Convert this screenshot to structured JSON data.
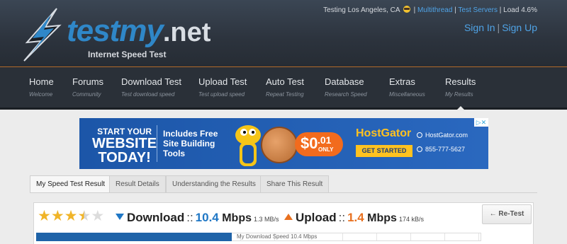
{
  "top_info": {
    "location": "Testing Los Angeles, CA",
    "multithread": "Multithread",
    "test_servers": "Test Servers",
    "load": "Load 4.6%"
  },
  "auth": {
    "sign_in": "Sign In",
    "sign_up": "Sign Up",
    "separator": "|"
  },
  "logo": {
    "name": "testmy",
    "tld": ".net",
    "tagline": "Internet Speed Test"
  },
  "nav": [
    {
      "title": "Home",
      "sub": "Welcome"
    },
    {
      "title": "Forums",
      "sub": "Community"
    },
    {
      "title": "Download Test",
      "sub": "Test download speed"
    },
    {
      "title": "Upload Test",
      "sub": "Test upload speed"
    },
    {
      "title": "Auto Test",
      "sub": "Repeat Testing"
    },
    {
      "title": "Database",
      "sub": "Research Speed"
    },
    {
      "title": "Extras",
      "sub": "Miscellaneous"
    },
    {
      "title": "Results",
      "sub": "My Results"
    }
  ],
  "ad": {
    "line1": "START YOUR",
    "line2": "WEBSITE",
    "line3": "TODAY!",
    "mid1": "Includes Free",
    "mid2": "Site Building",
    "mid3": "Tools",
    "price_dollar": "$0",
    "price_cents": ".01",
    "price_only": "ONLY",
    "brand": "HostGator",
    "cta": "GET STARTED",
    "website": "HostGator.com",
    "phone": "855-777-5627",
    "adchoices": "▷✕"
  },
  "tabs": [
    "My Speed Test Result",
    "Result Details",
    "Understanding the Results",
    "Share This Result"
  ],
  "result": {
    "rating": 3.5,
    "rating_max": 5,
    "download_label": "Download",
    "download_value": "10.4",
    "download_unit": "Mbps",
    "download_small": "1.3 MB/s",
    "upload_label": "Upload",
    "upload_value": "1.4",
    "upload_unit": "Mbps",
    "upload_small": "174 kB/s",
    "separator": "::",
    "retest": "← Re-Test",
    "bar_label": "My Download Speed 10.4 Mbps",
    "bar_fill_fraction": 0.44
  },
  "colors": {
    "accent": "#2f87c8",
    "download": "#1f77c5",
    "upload": "#e8701f",
    "bar": "#1f63a8"
  }
}
